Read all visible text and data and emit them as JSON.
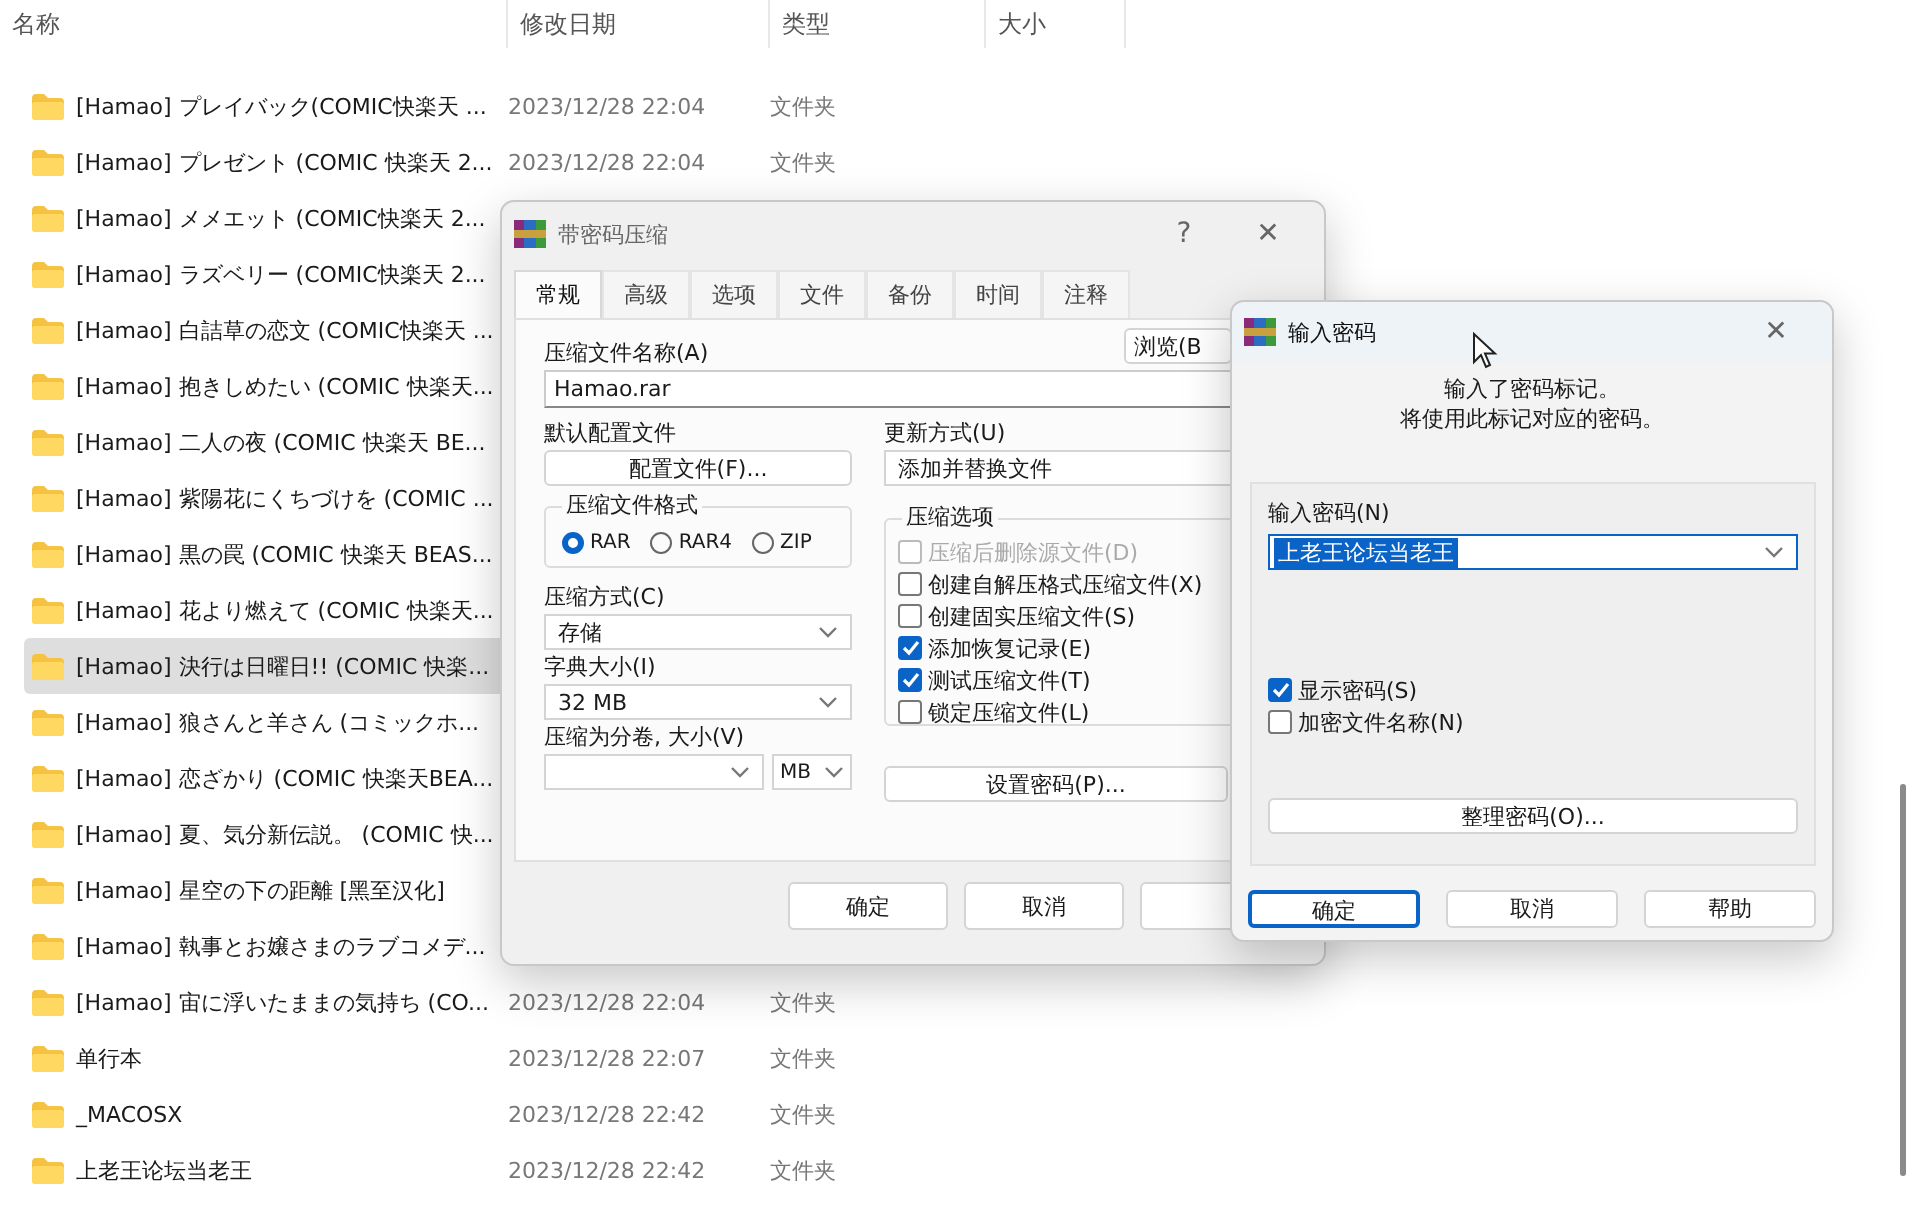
{
  "explorer": {
    "columns": [
      "名称",
      "修改日期",
      "类型",
      "大小"
    ],
    "rows": [
      {
        "name": "[Hamao] プレイバック(COMIC快楽天 ...",
        "modified": "2023/12/28 22:04",
        "type": "文件夹",
        "selected": false
      },
      {
        "name": "[Hamao] プレゼント (COMIC 快楽天 2...",
        "modified": "2023/12/28 22:04",
        "type": "文件夹",
        "selected": false
      },
      {
        "name": "[Hamao] メメエット (COMIC快楽天 2...",
        "selected": false
      },
      {
        "name": "[Hamao] ラズベリー (COMIC快楽天 2...",
        "selected": false
      },
      {
        "name": "[Hamao] 白詰草の恋文 (COMIC快楽天 ...",
        "selected": false
      },
      {
        "name": "[Hamao] 抱きしめたい (COMIC 快楽天...",
        "selected": false
      },
      {
        "name": "[Hamao] 二人の夜 (COMIC 快楽天 BE...",
        "selected": false
      },
      {
        "name": "[Hamao] 紫陽花にくちづけを (COMIC ...",
        "selected": false
      },
      {
        "name": "[Hamao] 黒の罠 (COMIC 快楽天 BEAS...",
        "selected": false
      },
      {
        "name": "[Hamao] 花より燃えて (COMIC 快楽天...",
        "selected": false
      },
      {
        "name": "[Hamao] 決行は日曜日!! (COMIC 快楽...",
        "selected": true
      },
      {
        "name": "[Hamao] 狼さんと羊さん (コミックホ...",
        "selected": false
      },
      {
        "name": "[Hamao] 恋ざかり (COMIC 快楽天BEA...",
        "selected": false
      },
      {
        "name": "[Hamao] 夏、気分新伝説。 (COMIC 快...",
        "selected": false
      },
      {
        "name": "[Hamao] 星空の下の距離 [黑至汉化]",
        "selected": false
      },
      {
        "name": "[Hamao] 執事とお嬢さまのラブコメデ...",
        "selected": false
      },
      {
        "name": "[Hamao] 宙に浮いたままの気持ち (CO...",
        "modified": "2023/12/28 22:04",
        "type": "文件夹",
        "selected": false
      },
      {
        "name": "单行本",
        "modified": "2023/12/28 22:07",
        "type": "文件夹",
        "selected": false
      },
      {
        "name": "_MACOSX",
        "modified": "2023/12/28 22:42",
        "type": "文件夹",
        "selected": false
      },
      {
        "name": "上老王论坛当老王",
        "modified": "2023/12/28 22:42",
        "type": "文件夹",
        "selected": false
      }
    ]
  },
  "compress_dialog": {
    "title": "带密码压缩",
    "help_glyph": "?",
    "close_glyph": "✕",
    "tabs": [
      {
        "label": "常规",
        "selected": true
      },
      {
        "label": "高级",
        "selected": false
      },
      {
        "label": "选项",
        "selected": false
      },
      {
        "label": "文件",
        "selected": false
      },
      {
        "label": "备份",
        "selected": false
      },
      {
        "label": "时间",
        "selected": false
      },
      {
        "label": "注释",
        "selected": false
      }
    ],
    "archive_name_label": "压缩文件名称(A)",
    "archive_name": "Hamao.rar",
    "browse_button": "浏览(B",
    "profile_label": "默认配置文件",
    "profile_button": "配置文件(F)...",
    "update_label": "更新方式(U)",
    "update_mode": "添加并替换文件",
    "format_group": {
      "title": "压缩文件格式",
      "options": [
        {
          "label": "RAR",
          "selected": true
        },
        {
          "label": "RAR4",
          "selected": false
        },
        {
          "label": "ZIP",
          "selected": false
        }
      ]
    },
    "options_group": {
      "title": "压缩选项",
      "items": [
        {
          "label": "压缩后删除源文件(D)",
          "checked": false,
          "disabled": true
        },
        {
          "label": "创建自解压格式压缩文件(X)",
          "checked": false,
          "disabled": false
        },
        {
          "label": "创建固实压缩文件(S)",
          "checked": false,
          "disabled": false
        },
        {
          "label": "添加恢复记录(E)",
          "checked": true,
          "disabled": false
        },
        {
          "label": "测试压缩文件(T)",
          "checked": true,
          "disabled": false
        },
        {
          "label": "锁定压缩文件(L)",
          "checked": false,
          "disabled": false
        }
      ]
    },
    "method_label": "压缩方式(C)",
    "method": "存储",
    "dict_label": "字典大小(I)",
    "dict": "32 MB",
    "volume_label": "压缩为分卷, 大小(V)",
    "volume_unit": "MB",
    "password_button": "设置密码(P)...",
    "buttons": [
      "确定",
      "取消"
    ]
  },
  "password_dialog": {
    "title": "输入密码",
    "close_glyph": "✕",
    "message": [
      "输入了密码标记。",
      "将使用此标记对应的密码。"
    ],
    "password_label": "输入密码(N)",
    "password_value": "上老王论坛当老王",
    "value_highlighted": true,
    "checks": [
      {
        "label": "显示密码(S)",
        "checked": true
      },
      {
        "label": "加密文件名称(N)",
        "checked": false
      }
    ],
    "organize_button": "整理密码(O)...",
    "buttons": [
      {
        "label": "确定",
        "default": true
      },
      {
        "label": "取消",
        "default": false
      },
      {
        "label": "帮助",
        "default": false
      }
    ]
  }
}
